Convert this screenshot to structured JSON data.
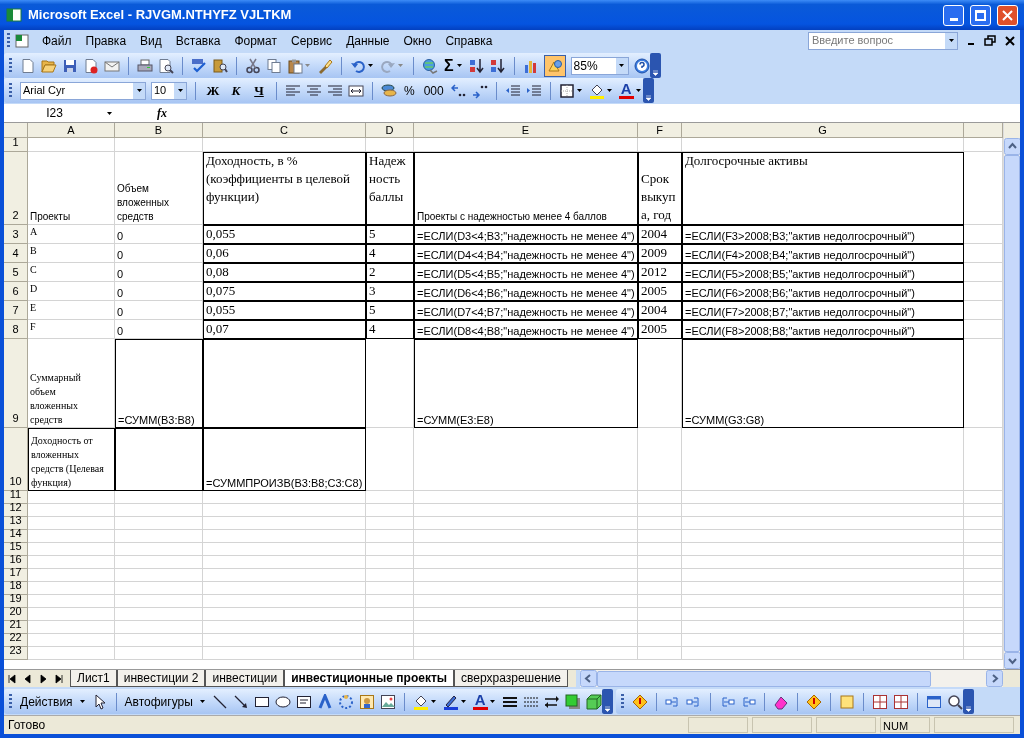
{
  "window": {
    "title": "Microsoft Excel - RJVGM.NTHYFZ VJLTKM"
  },
  "menu": [
    "Файл",
    "Правка",
    "Вид",
    "Вставка",
    "Формат",
    "Сервис",
    "Данные",
    "Окно",
    "Справка"
  ],
  "help_box": {
    "placeholder": "Введите вопрос"
  },
  "standard_toolbar": {
    "autosum": "Σ",
    "zoom": "85%"
  },
  "formatting_toolbar": {
    "font": "Arial Cyr",
    "size": "10",
    "style_buttons": [
      "Ж",
      "К",
      "Ч"
    ],
    "number_buttons": [
      "%",
      "000"
    ],
    "font_color": "A"
  },
  "formula_bar": {
    "name_box": "I23",
    "function_label": "fx"
  },
  "sheet": {
    "columns": [
      "A",
      "B",
      "C",
      "D",
      "E",
      "F",
      "G"
    ],
    "rows": [
      {
        "number": "1"
      },
      {
        "number": "2",
        "cells": [
          "Проекты",
          "Объем вложенных средств",
          "Доходность, в % (коэффициенты в целевой функции)",
          "Надежность баллы",
          "Проекты с надежностью менее 4 баллов",
          "Срок выкупа, год",
          "Долгосрочные активы"
        ]
      },
      {
        "number": "3",
        "cells": [
          "A",
          "0",
          "0,055",
          "5",
          "=ЕСЛИ(D3<4;B3;\"надежность не менее 4\")",
          "2004",
          "=ЕСЛИ(F3>2008;B3;\"актив недолгосрочный\")"
        ]
      },
      {
        "number": "4",
        "cells": [
          "B",
          "0",
          "0,06",
          "4",
          "=ЕСЛИ(D4<4;B4;\"надежность не менее 4\")",
          "2009",
          "=ЕСЛИ(F4>2008;B4;\"актив недолгосрочный\")"
        ]
      },
      {
        "number": "5",
        "cells": [
          "C",
          "0",
          "0,08",
          "2",
          "=ЕСЛИ(D5<4;B5;\"надежность не менее 4\")",
          "2012",
          "=ЕСЛИ(F5>2008;B5;\"актив недолгосрочный\")"
        ]
      },
      {
        "number": "6",
        "cells": [
          "D",
          "0",
          "0,075",
          "3",
          "=ЕСЛИ(D6<4;B6;\"надежность не менее 4\")",
          "2005",
          "=ЕСЛИ(F6>2008;B6;\"актив недолгосрочный\")"
        ]
      },
      {
        "number": "7",
        "cells": [
          "E",
          "0",
          "0,055",
          "5",
          "=ЕСЛИ(D7<4;B7;\"надежность не менее 4\")",
          "2004",
          "=ЕСЛИ(F7>2008;B7;\"актив недолгосрочный\")"
        ]
      },
      {
        "number": "8",
        "cells": [
          "F",
          "0",
          "0,07",
          "4",
          "=ЕСЛИ(D8<4;B8;\"надежность не менее 4\")",
          "2005",
          "=ЕСЛИ(F8>2008;B8;\"актив недолгосрочный\")"
        ]
      },
      {
        "number": "9",
        "cells": [
          "Суммарный объем вложенных средств",
          "=СУММ(B3:B8)",
          null,
          null,
          "=СУММ(E3:E8)",
          null,
          "=СУММ(G3:G8)"
        ]
      },
      {
        "number": "10",
        "cells": [
          "Доходность от вложенных средств (Целевая функция)",
          null,
          "=СУММПРОИЗВ(B3:B8;C3:C8)"
        ]
      },
      {
        "number": "11"
      },
      {
        "number": "12"
      },
      {
        "number": "13"
      },
      {
        "number": "14"
      },
      {
        "number": "15"
      },
      {
        "number": "16"
      },
      {
        "number": "17"
      },
      {
        "number": "18"
      },
      {
        "number": "19"
      },
      {
        "number": "20"
      },
      {
        "number": "21"
      },
      {
        "number": "22"
      },
      {
        "number": "23"
      }
    ]
  },
  "sheet_tabs": [
    {
      "label": "Лист1",
      "selected": false
    },
    {
      "label": "инвестиции 2",
      "selected": false
    },
    {
      "label": "инвестиции",
      "selected": false
    },
    {
      "label": "инвестиционные проекты",
      "selected": true
    },
    {
      "label": "сверхразрешение",
      "selected": false
    }
  ],
  "drawing_toolbar": {
    "actions": "Действия",
    "autoshapes": "Автофигуры",
    "font_color": "A"
  },
  "status_bar": {
    "message": "Готово",
    "indicator": "NUM"
  }
}
